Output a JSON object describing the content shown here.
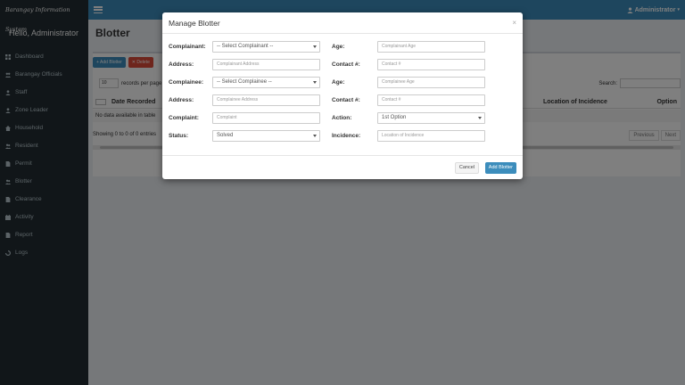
{
  "app": {
    "brand": "Barangay Information System",
    "greeting": "Hello, Administrator",
    "user_menu": "Administrator"
  },
  "sidebar": {
    "items": [
      {
        "label": "Dashboard",
        "icon": "dashboard-icon"
      },
      {
        "label": "Barangay Officials",
        "icon": "officials-icon"
      },
      {
        "label": "Staff",
        "icon": "user-icon"
      },
      {
        "label": "Zone Leader",
        "icon": "user-icon"
      },
      {
        "label": "Household",
        "icon": "home-icon"
      },
      {
        "label": "Resident",
        "icon": "users-icon"
      },
      {
        "label": "Permit",
        "icon": "file-icon"
      },
      {
        "label": "Blotter",
        "icon": "users-icon"
      },
      {
        "label": "Clearance",
        "icon": "file-icon"
      },
      {
        "label": "Activity",
        "icon": "calendar-icon"
      },
      {
        "label": "Report",
        "icon": "file-icon"
      },
      {
        "label": "Logs",
        "icon": "history-icon"
      }
    ]
  },
  "page": {
    "title": "Blotter",
    "add_button": "Add Blotter",
    "delete_button": "Delete",
    "length_value": "10",
    "length_suffix": "records per page",
    "search_label": "Search:",
    "columns": {
      "date": "Date Recorded",
      "location": "Location of Incidence",
      "option": "Option"
    },
    "empty_text": "No data available in table",
    "info_text": "Showing 0 to 0 of 0 entries",
    "prev": "Previous",
    "next": "Next"
  },
  "modal": {
    "title": "Manage Blotter",
    "close": "×",
    "rows": [
      {
        "left_label": "Complainant:",
        "left_value": "-- Select Complainant --",
        "left_type": "select",
        "right_label": "Age:",
        "right_value": "Complainant Age",
        "right_type": "input"
      },
      {
        "left_label": "Address:",
        "left_value": "Complainant Address",
        "left_type": "input",
        "right_label": "Contact #:",
        "right_value": "Contact #",
        "right_type": "input"
      },
      {
        "left_label": "Complainee:",
        "left_value": "-- Select Complainee --",
        "left_type": "select",
        "right_label": "Age:",
        "right_value": "Complainee Age",
        "right_type": "input"
      },
      {
        "left_label": "Address:",
        "left_value": "Complainee Address",
        "left_type": "input",
        "right_label": "Contact #:",
        "right_value": "Contact #",
        "right_type": "input"
      },
      {
        "left_label": "Complaint:",
        "left_value": "Complaint",
        "left_type": "input",
        "right_label": "Action:",
        "right_value": "1st Option",
        "right_type": "select"
      },
      {
        "left_label": "Status:",
        "left_value": "Solved",
        "left_type": "select",
        "right_label": "Incidence:",
        "right_value": "Location of Incidence",
        "right_type": "input"
      }
    ],
    "cancel_button": "Cancel",
    "submit_button": "Add Blotter"
  }
}
